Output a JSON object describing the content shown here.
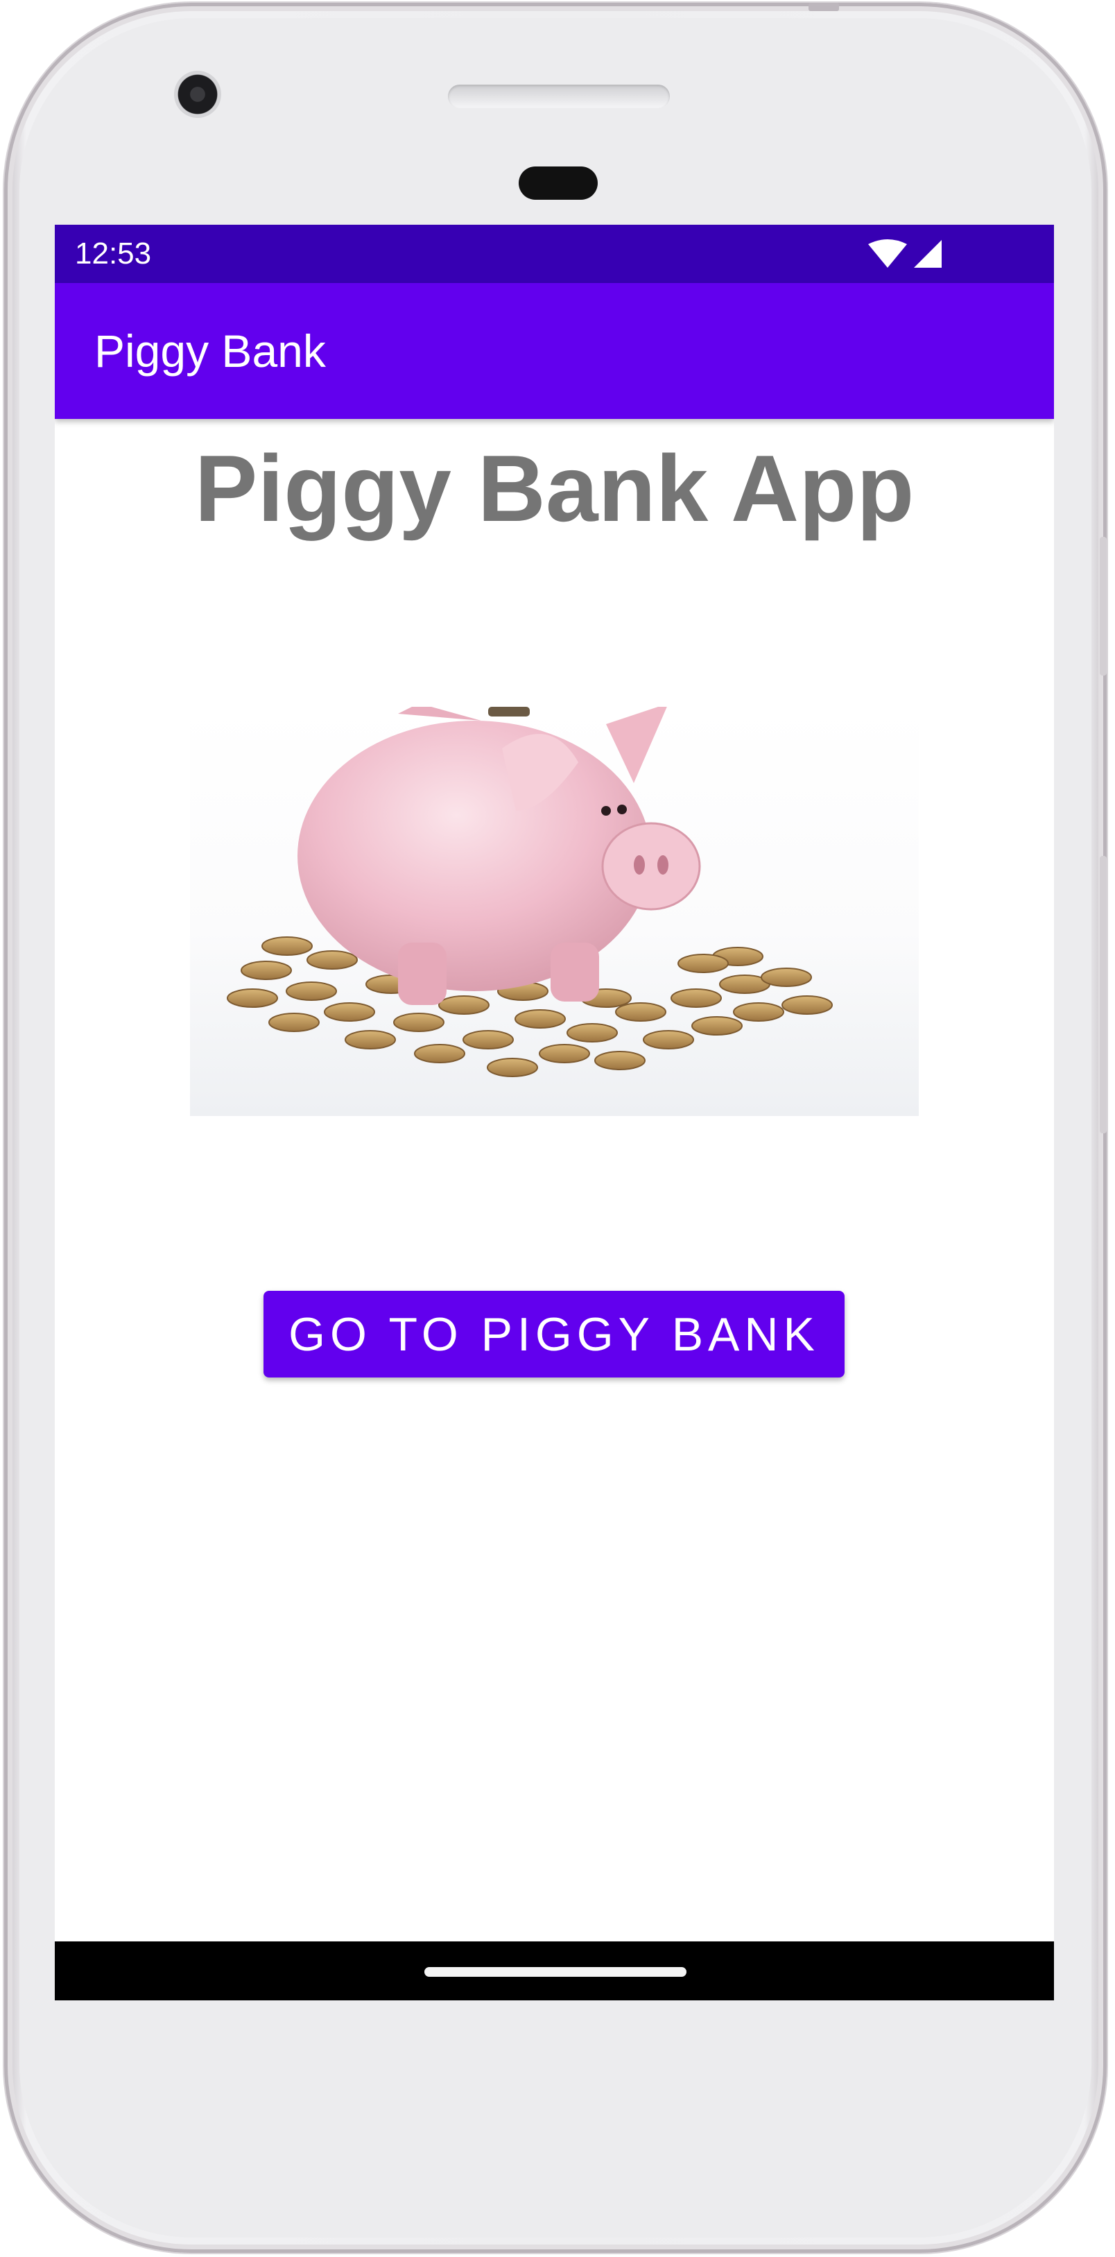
{
  "status_bar": {
    "time": "12:53",
    "icons": [
      "wifi-icon",
      "cellular-signal-icon"
    ]
  },
  "app_bar": {
    "title": "Piggy Bank"
  },
  "main": {
    "heading": "Piggy Bank App",
    "image": "piggy-bank-with-coins",
    "button_label": "GO TO PIGGY BANK"
  },
  "colors": {
    "status_bar": "#3700b3",
    "primary": "#6200ee",
    "heading_text": "#757575",
    "piggy_pink": "#f2c1cc",
    "coins": "#b58a4e"
  }
}
